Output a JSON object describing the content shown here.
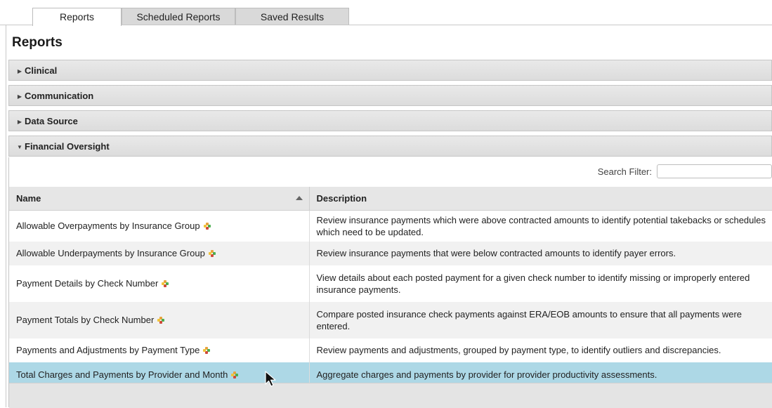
{
  "tabs": [
    {
      "label": "Reports",
      "active": true
    },
    {
      "label": "Scheduled Reports",
      "active": false
    },
    {
      "label": "Saved Results",
      "active": false
    }
  ],
  "page_title": "Reports",
  "sections": [
    {
      "label": "Clinical",
      "expanded": false
    },
    {
      "label": "Communication",
      "expanded": false
    },
    {
      "label": "Data Source",
      "expanded": false
    },
    {
      "label": "Financial Oversight",
      "expanded": true
    }
  ],
  "search": {
    "label": "Search Filter:",
    "value": "",
    "placeholder": ""
  },
  "table": {
    "columns": [
      "Name",
      "Description"
    ],
    "sort": {
      "column": "Name",
      "direction": "ascending"
    },
    "rows": [
      {
        "name": "Allowable Overpayments by Insurance Group",
        "description": "Review insurance payments which were above contracted amounts to identify potential takebacks or schedules which need to be updated.",
        "selected": false
      },
      {
        "name": "Allowable Underpayments by Insurance Group",
        "description": "Review insurance payments that were below contracted amounts to identify payer errors.",
        "selected": false
      },
      {
        "name": "Payment Details by Check Number",
        "description": "View details about each posted payment for a given check number to identify missing or improperly entered insurance payments.",
        "selected": false
      },
      {
        "name": "Payment Totals by Check Number",
        "description": "Compare posted insurance check payments against ERA/EOB amounts to ensure that all payments were entered.",
        "selected": false
      },
      {
        "name": "Payments and Adjustments by Payment Type",
        "description": "Review payments and adjustments, grouped by payment type, to identify outliers and discrepancies.",
        "selected": false
      },
      {
        "name": "Total Charges and Payments by Provider and Month",
        "description": "Aggregate charges and payments by provider for provider productivity assessments.",
        "selected": true
      }
    ]
  },
  "icons": {
    "favorite": "add-favorite-icon",
    "collapsed": "triangle-right-icon",
    "expanded": "triangle-down-icon",
    "sort": "sort-ascending-icon"
  },
  "colors": {
    "selected_row": "#add8e6",
    "section_header": "#e2e2e2",
    "tab_inactive": "#d9d9d9"
  }
}
